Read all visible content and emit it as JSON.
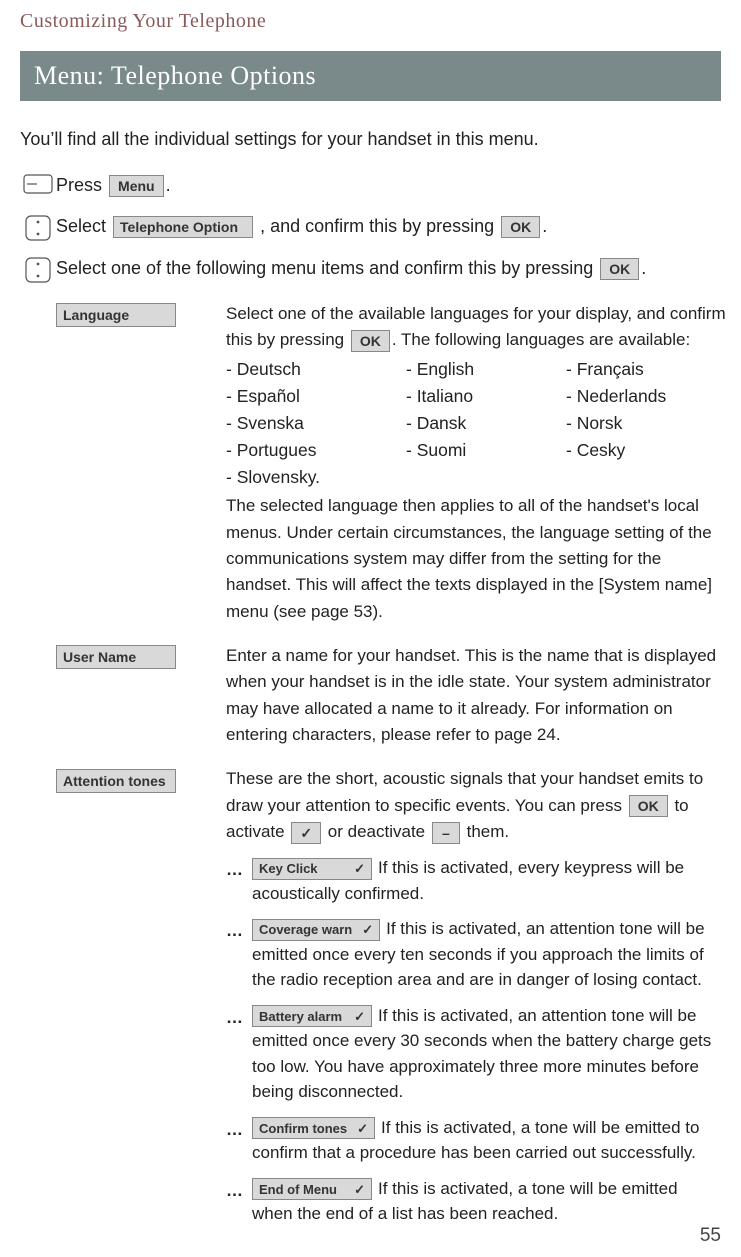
{
  "page": {
    "heading": "Customizing Your Telephone",
    "section_title": "Menu: Telephone Options",
    "intro": "You’ll find all the individual settings for your handset in this menu.",
    "page_number": "55"
  },
  "keys": {
    "menu": "Menu",
    "telephone_option": "Telephone Option",
    "ok": "OK",
    "check": "✓",
    "dash": "–"
  },
  "steps": {
    "press_pre": "Press",
    "press_post": ".",
    "select_pre": "Select",
    "select_mid": ", and confirm this by pressing",
    "select_post": ".",
    "select2_pre": "Select one of the following menu items and confirm this by pressing ",
    "select2_post": "."
  },
  "options": {
    "language": {
      "label": "Language",
      "text1_pre": "Select one of the available languages for your display, and confirm this by pressing",
      "text1_post": ". The following languages are available:",
      "langs": [
        "- Deutsch",
        "- English",
        "- Français",
        "- Español",
        "- Italiano",
        "- Nederlands",
        "- Svenska",
        "- Dansk",
        "- Norsk",
        "- Portugues",
        "- Suomi",
        "- Cesky",
        "- Slovensky."
      ],
      "note": "The selected language then applies to all of the handset's local menus. Under certain circumstances, the language setting of the communica­tions system may differ from the setting for the handset. This will affect the texts displayed in the [System name] menu (see page 53)."
    },
    "user_name": {
      "label": "User Name",
      "text": "Enter a name for your handset. This is the name that is displayed when your handset is in the idle state. Your system administrator may have allocated a name to it already. For information on entering characters, please refer to page 24."
    },
    "attention": {
      "label": "Attention tones",
      "text_pre": "These are the short, acoustic signals that your handset emits to draw your attention to specific events. You can press",
      "text_mid": "to activate",
      "text_mid2": "or deactivate",
      "text_post": "them.",
      "subs": {
        "key_click": {
          "label": "Key Click",
          "text": "If this is activated, every keypress will be acoustically confirmed."
        },
        "coverage": {
          "label": "Coverage warn",
          "text": "If this is activated, an attention tone will be emitted once every ten seconds if you approach the limits of the radio reception area and are in danger of losing contact."
        },
        "battery": {
          "label": "Battery alarm",
          "text": "If this is activated, an attention tone will be emitted once every 30 seconds when the battery charge gets too low. You have approximately three more minutes before being disconnected."
        },
        "confirm": {
          "label": "Confirm tones",
          "text": "If this is activated, a tone will be emitted to confirm that a procedure has been carried out successfully."
        },
        "end": {
          "label": "End of Menu",
          "text": "If this is activated, a tone will be emitted when the end of a list has been reached."
        }
      }
    }
  }
}
